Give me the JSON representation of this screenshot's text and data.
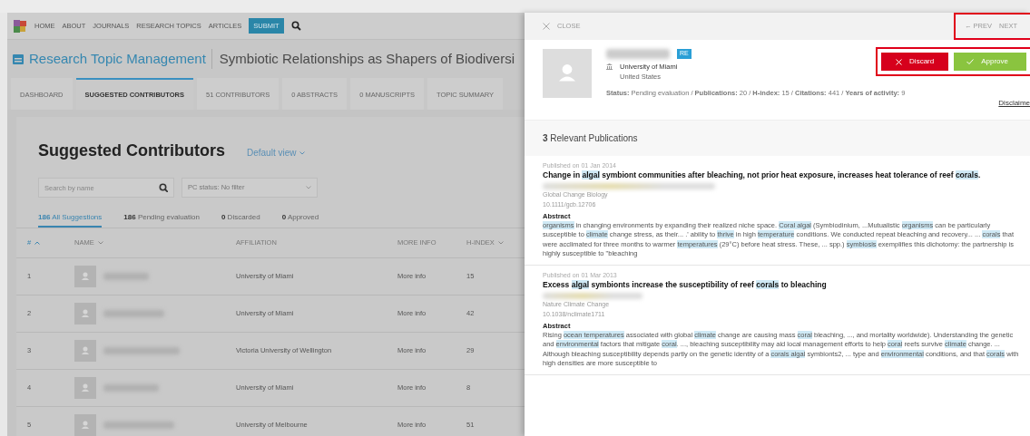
{
  "nav": {
    "items": [
      "HOME",
      "ABOUT",
      "JOURNALS",
      "RESEARCH TOPICS",
      "ARTICLES"
    ],
    "submit": "SUBMIT"
  },
  "header": {
    "title": "Research Topic Management",
    "topic": "Symbiotic Relationships as Shapers of Biodiversi"
  },
  "tabs": [
    {
      "label": "DASHBOARD",
      "selected": false
    },
    {
      "label": "SUGGESTED CONTRIBUTORS",
      "selected": true
    },
    {
      "label": "51 CONTRIBUTORS",
      "selected": false
    },
    {
      "label": "0 ABSTRACTS",
      "selected": false
    },
    {
      "label": "0 MANUSCRIPTS",
      "selected": false
    },
    {
      "label": "TOPIC SUMMARY",
      "selected": false
    }
  ],
  "page_title": "Suggested Contributors",
  "view_menu": "Default view",
  "search": {
    "placeholder": "Search by name"
  },
  "status_filter": "PC status: No filter",
  "filters": [
    {
      "count": "186",
      "label": "All Suggestions",
      "selected": true
    },
    {
      "count": "186",
      "label": "Pending evaluation",
      "selected": false
    },
    {
      "count": "0",
      "label": "Discarded",
      "selected": false
    },
    {
      "count": "0",
      "label": "Approved",
      "selected": false
    }
  ],
  "table": {
    "columns": [
      "#",
      "NAME",
      "AFFILIATION",
      "MORE INFO",
      "H-INDEX"
    ],
    "rows": [
      {
        "number": "1",
        "affiliation": "University of Miami",
        "more_info": "More info",
        "h_index": "15"
      },
      {
        "number": "2",
        "affiliation": "University of Miami",
        "more_info": "More info",
        "h_index": "42"
      },
      {
        "number": "3",
        "affiliation": "Victoria University of Wellington",
        "more_info": "More info",
        "h_index": "29"
      },
      {
        "number": "4",
        "affiliation": "University of Miami",
        "more_info": "More info",
        "h_index": "8"
      },
      {
        "number": "5",
        "affiliation": "University of Melbourne",
        "more_info": "More info",
        "h_index": "51"
      }
    ]
  },
  "panel": {
    "close": "CLOSE",
    "prev": "← PREV",
    "next": "NEXT",
    "profile": {
      "badge": "RE",
      "institution": "University of Miami",
      "country": "United States",
      "stats": "**Status:** Pending evaluation / **Publications:** 20 / **H-index:** 15 / **Citations:** 441 / **Years of activity:** 9"
    },
    "discard": "Discard",
    "approve": "Approve",
    "disclaimer": "Disclaime",
    "publications_header": "**3** Relevant Publications",
    "publications": [
      {
        "date": "Published on 01 Jan 2014",
        "journal": "Global Change Biology",
        "doi": "10.1111/gcb.12706",
        "abstract_label": "Abstract",
        "title": [
          {
            "text": "Change in ",
            "highlight": false
          },
          {
            "text": "algal",
            "highlight": true
          },
          {
            "text": " symbiont communities after bleaching, not prior heat exposure, increases heat tolerance of reef ",
            "highlight": false
          },
          {
            "text": "corals",
            "highlight": true
          },
          {
            "text": ".",
            "highlight": false
          }
        ],
        "abstract": [
          {
            "text": "organisms",
            "highlight": true
          },
          {
            "text": " in changing environments by expanding their realized niche space. ",
            "highlight": false
          },
          {
            "text": "Coral algal",
            "highlight": true
          },
          {
            "text": " (Symbiodinium, ...Mutualistic ",
            "highlight": false
          },
          {
            "text": "organisms",
            "highlight": true
          },
          {
            "text": " can be particularly susceptible to ",
            "highlight": false
          },
          {
            "text": "climate",
            "highlight": true
          },
          {
            "text": " change stress, as their... .' ability to ",
            "highlight": false
          },
          {
            "text": "thrive",
            "highlight": true
          },
          {
            "text": " in high ",
            "highlight": false
          },
          {
            "text": "temperature",
            "highlight": true
          },
          {
            "text": " conditions. We conducted repeat bleaching and recovery... ... ",
            "highlight": false
          },
          {
            "text": "corals",
            "highlight": true
          },
          {
            "text": " that were acclimated for three months to warmer ",
            "highlight": false
          },
          {
            "text": "temperatures",
            "highlight": true
          },
          {
            "text": " (29°C) before heat stress. These, ... spp.) ",
            "highlight": false
          },
          {
            "text": "symbiosis",
            "highlight": true
          },
          {
            "text": " exemplifies this dichotomy: the partnership is highly susceptible to \"bleaching",
            "highlight": false
          }
        ]
      },
      {
        "date": "Published on 01 Mar 2013",
        "journal": "Nature Climate Change",
        "doi": "10.1038/nclimate1711",
        "abstract_label": "Abstract",
        "title": [
          {
            "text": "Excess ",
            "highlight": false
          },
          {
            "text": "algal",
            "highlight": true
          },
          {
            "text": " symbionts increase the susceptibility of reef ",
            "highlight": false
          },
          {
            "text": "corals",
            "highlight": true
          },
          {
            "text": " to bleaching",
            "highlight": false
          }
        ],
        "abstract": [
          {
            "text": "Rising ",
            "highlight": false
          },
          {
            "text": "ocean temperatures",
            "highlight": true
          },
          {
            "text": " associated with global ",
            "highlight": false
          },
          {
            "text": "climate",
            "highlight": true
          },
          {
            "text": " change are causing mass ",
            "highlight": false
          },
          {
            "text": "coral",
            "highlight": true
          },
          {
            "text": " bleaching, ..., and mortality worldwide). Understanding the genetic and ",
            "highlight": false
          },
          {
            "text": "environmental",
            "highlight": true
          },
          {
            "text": " factors that mitigate ",
            "highlight": false
          },
          {
            "text": "coral",
            "highlight": true
          },
          {
            "text": ". ..., bleaching susceptibility may aid local management efforts to help ",
            "highlight": false
          },
          {
            "text": "coral",
            "highlight": true
          },
          {
            "text": " reefs survive ",
            "highlight": false
          },
          {
            "text": "climate",
            "highlight": true
          },
          {
            "text": " change. ... Although bleaching susceptibility depends partly on the genetic identity of a ",
            "highlight": false
          },
          {
            "text": "corals algal",
            "highlight": true
          },
          {
            "text": " symbionts2, ... type and ",
            "highlight": false
          },
          {
            "text": "environmental",
            "highlight": true
          },
          {
            "text": " conditions, and that ",
            "highlight": false
          },
          {
            "text": "corals",
            "highlight": true
          },
          {
            "text": " with high densities are more susceptible to",
            "highlight": false
          }
        ]
      }
    ]
  }
}
